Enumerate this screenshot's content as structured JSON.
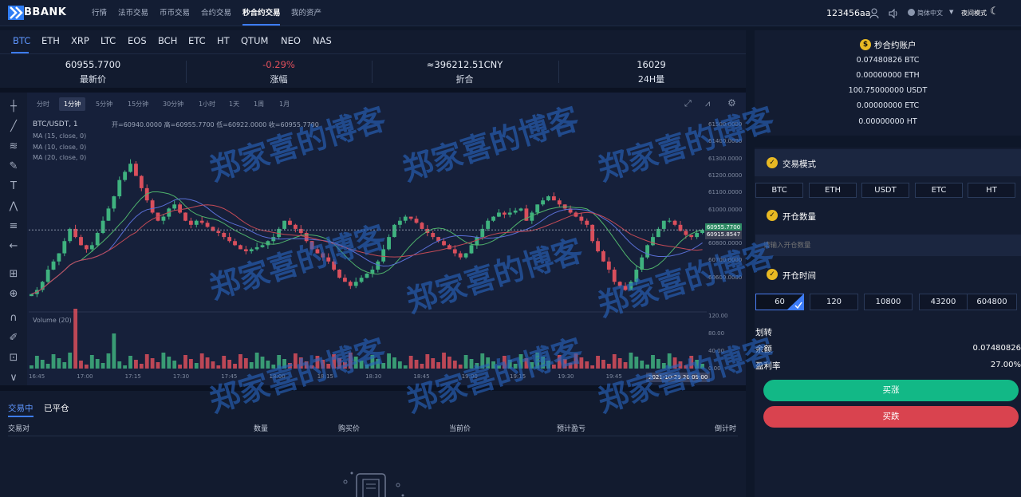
{
  "brand": "BBANK",
  "nav": {
    "items": [
      "行情",
      "法币交易",
      "币币交易",
      "合约交易",
      "秒合约交易",
      "我的资产"
    ],
    "user": "123456aa",
    "language": "简体中文",
    "mode": "夜间模式"
  },
  "coins": [
    "BTC",
    "ETH",
    "XRP",
    "LTC",
    "EOS",
    "BCH",
    "ETC",
    "HT",
    "QTUM",
    "NEO",
    "NAS"
  ],
  "stats": [
    {
      "value": "60955.7700",
      "label": "最新价"
    },
    {
      "value": "-0.29%",
      "label": "涨幅"
    },
    {
      "value": "≈396212.51CNY",
      "label": "折合"
    },
    {
      "value": "16029",
      "label": "24H量"
    }
  ],
  "colors": {
    "up": "#3fb27f",
    "down": "#d94f5c",
    "accent": "#3d7cf6",
    "buy": "#12b886",
    "sell": "#d9434f",
    "gold": "#e8b923"
  },
  "chart": {
    "timeframes": [
      "分时",
      "1分钟",
      "5分钟",
      "15分钟",
      "30分钟",
      "1小时",
      "1天",
      "1周",
      "1月"
    ],
    "active_timeframe": "1分钟",
    "symbol_line": "BTC/USDT, 1",
    "ohlc": "开=60940.0000  高=60955.7700  低=60922.0000  收=60955.7700",
    "ma_labels": [
      "MA (15, close, 0)",
      "MA (10, close, 0)",
      "MA (20, close, 0)"
    ],
    "volume_label": "Volume (20)",
    "price_ticks": [
      "61500.0000",
      "61400.0000",
      "61300.0000",
      "61200.0000",
      "61100.0000",
      "61000.0000",
      "60900.0000",
      "60800.0000",
      "60700.0000",
      "60600.0000"
    ],
    "last_price_tag": "60955.7700",
    "ma_tag": "60915.8547",
    "volume_ticks": [
      "120.00",
      "80.00",
      "40.00",
      "0.00"
    ],
    "time_ticks": [
      "16:45",
      "17:00",
      "17:15",
      "17:30",
      "17:45",
      "18:00",
      "18:15",
      "18:30",
      "18:45",
      "19:00",
      "19:15",
      "19:30",
      "19:45"
    ],
    "current_time": "2021-10-29 20:09:00"
  },
  "chart_data": {
    "type": "candlestick",
    "pair": "BTC/USDT",
    "interval": "1分钟",
    "ylim": [
      60560,
      61520
    ],
    "close_series": [
      60640,
      60660,
      60700,
      60760,
      60800,
      60840,
      60900,
      60960,
      60920,
      60880,
      60860,
      60880,
      60940,
      61000,
      61060,
      61120,
      61200,
      61240,
      61280,
      61220,
      61160,
      61100,
      61040,
      61000,
      61020,
      61060,
      61080,
      61040,
      61000,
      60980,
      61000,
      60990,
      60970,
      60950,
      60940,
      60920,
      60900,
      60880,
      60860,
      60850,
      60860,
      60870,
      60880,
      60900,
      60920,
      60960,
      61000,
      60980,
      60960,
      60940,
      60900,
      60860,
      60840,
      60820,
      60800,
      60760,
      60720,
      60700,
      60680,
      60700,
      60720,
      60740,
      60760,
      60800,
      60860,
      60920,
      60980,
      61000,
      61020,
      61010,
      60990,
      60960,
      60940,
      60920,
      60900,
      60880,
      60860,
      60840,
      60820,
      60840,
      60880,
      60920,
      60960,
      61000,
      61020,
      61040,
      61030,
      61040,
      61050,
      61060,
      61000,
      61040,
      61080,
      61100,
      61120,
      61100,
      61080,
      61060,
      61040,
      61020,
      61000,
      60980,
      60900,
      60850,
      60800,
      60760,
      60700,
      60680,
      60660,
      60700,
      60760,
      60820,
      60880,
      60920,
      60960,
      61000,
      61000,
      60980,
      60950,
      60930,
      60920,
      60940,
      60955
    ]
  },
  "account": {
    "title": "秒合约账户",
    "balances": [
      "0.07480826 BTC",
      "0.00000000 ETH",
      "100.75000000 USDT",
      "0.00000000 ETC",
      "0.00000000 HT"
    ]
  },
  "trade": {
    "mode_title": "交易模式",
    "currencies": [
      "BTC",
      "ETH",
      "USDT",
      "ETC",
      "HT"
    ],
    "qty_title": "开仓数量",
    "qty_placeholder": "请输入开仓数量",
    "time_title": "开仓时间",
    "times": [
      "60",
      "120",
      "10800",
      "43200",
      "604800"
    ],
    "transfer_label": "划转",
    "balance_label": "余额",
    "balance_value": "0.07480826",
    "profit_label": "盈利率",
    "profit_value": "27.00%",
    "buy_up": "买涨",
    "buy_down": "买跌"
  },
  "orders": {
    "tabs": [
      "交易中",
      "已平仓"
    ],
    "columns": [
      "交易对",
      "数量",
      "购买价",
      "当前价",
      "预计盈亏",
      "倒计时"
    ]
  },
  "watermark": "郑家喜的博客"
}
